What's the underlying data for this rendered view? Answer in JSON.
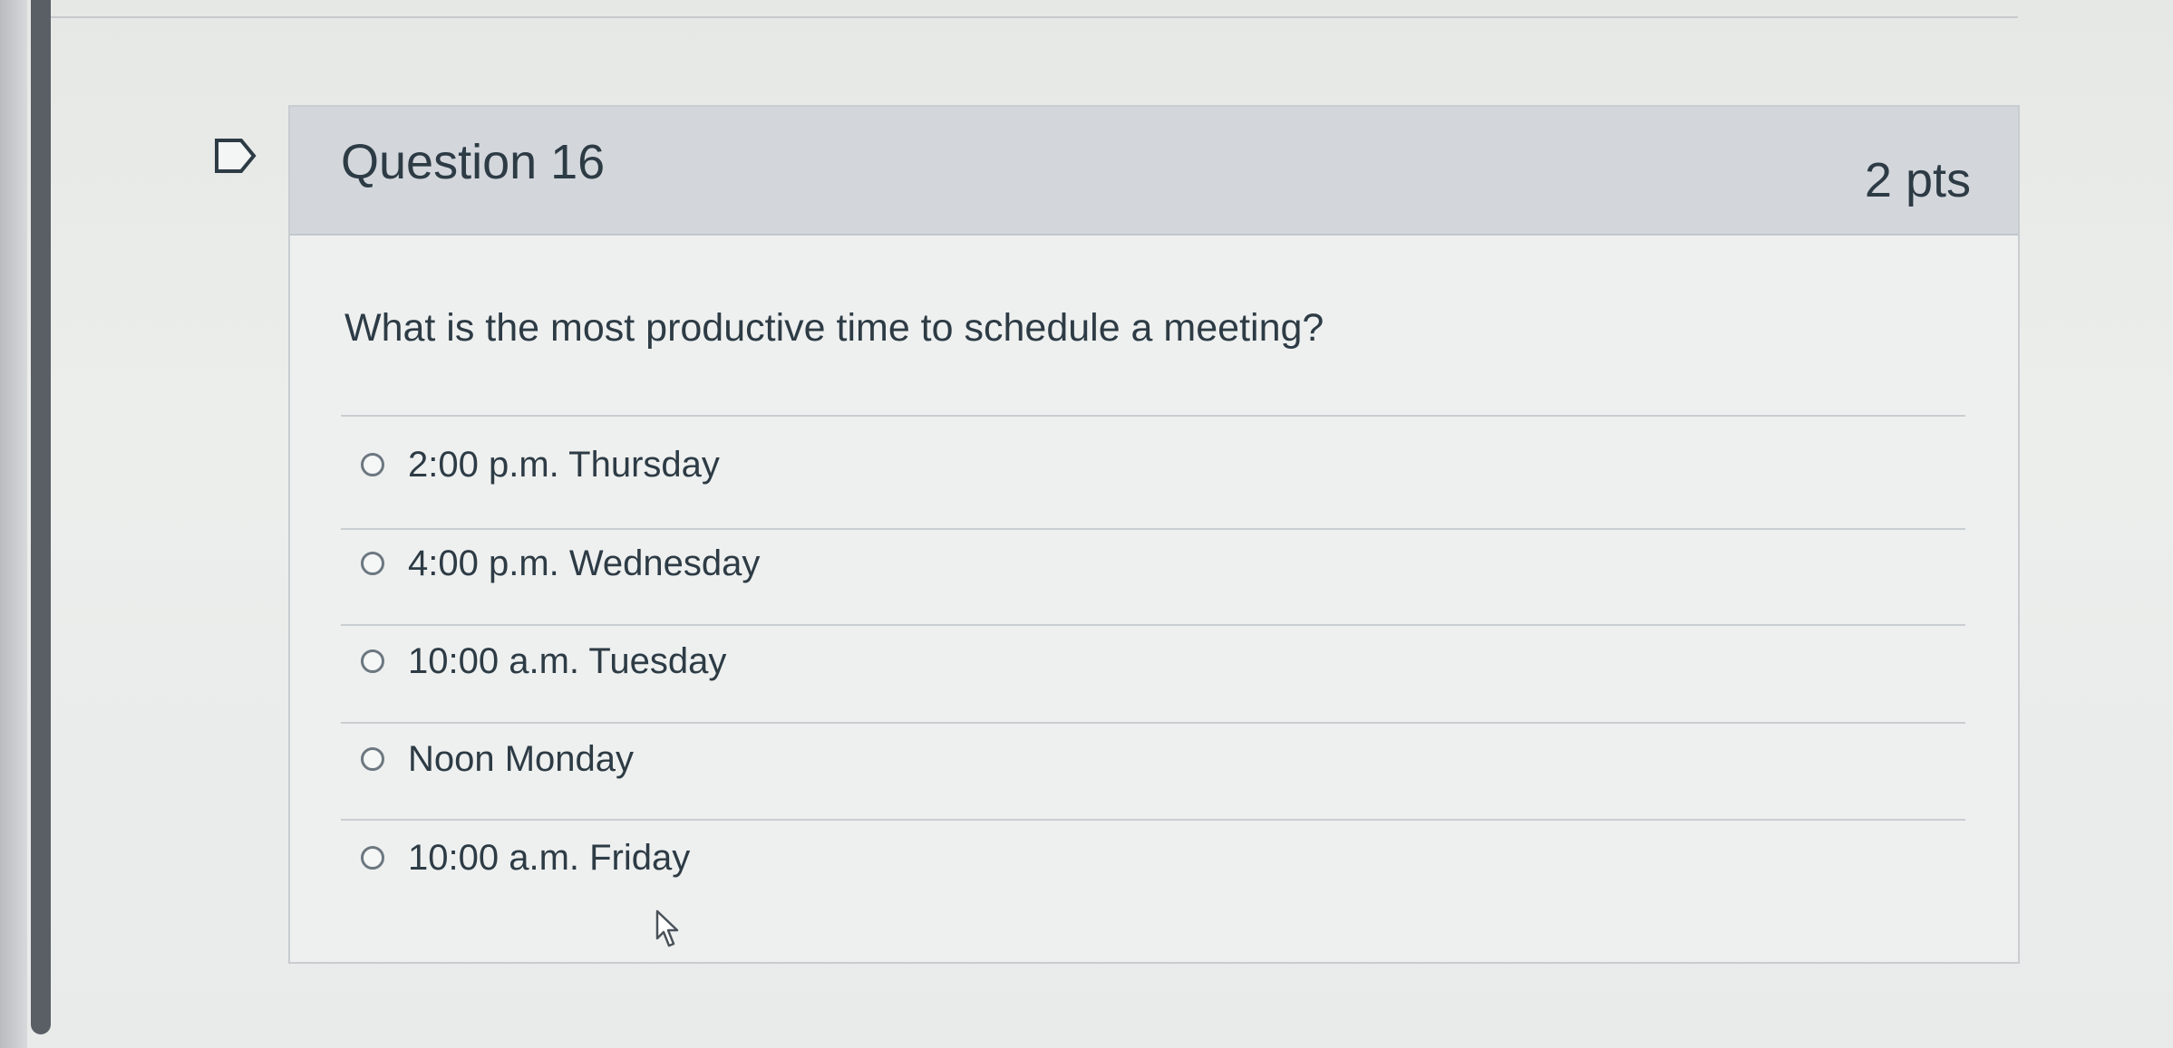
{
  "question": {
    "title": "Question 16",
    "points": "2 pts",
    "text": "What is the most productive time to schedule a meeting?"
  },
  "answers": [
    {
      "label": "2:00 p.m. Thursday"
    },
    {
      "label": "4:00 p.m. Wednesday"
    },
    {
      "label": "10:00 a.m. Tuesday"
    },
    {
      "label": "Noon Monday"
    },
    {
      "label": "10:00 a.m. Friday"
    }
  ],
  "icons": {
    "flag": "flag-icon",
    "cursor": "mouse-pointer-icon",
    "radio": "radio-button-icon"
  },
  "colors": {
    "header_background": "#d3d7dc",
    "text": "#2d3b45",
    "border": "#c7cdd1"
  }
}
